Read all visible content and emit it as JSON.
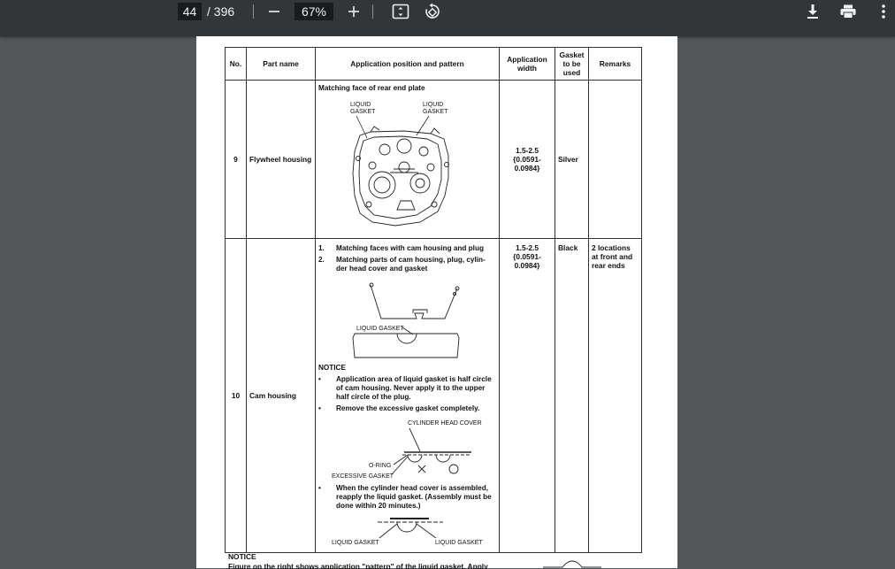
{
  "toolbar": {
    "page_current": "44",
    "page_total": "/ 396",
    "zoom": "67%"
  },
  "table": {
    "headers": {
      "no": "No.",
      "part_name": "Part name",
      "position": "Application position and pattern",
      "width": "Application width",
      "gasket": "Gasket to be used",
      "remarks": "Remarks"
    },
    "row9": {
      "no": "9",
      "part": "Flywheel housing",
      "position_title": "Matching face of rear end plate",
      "label_left_1": "LIQUID",
      "label_left_2": "GASKET",
      "label_right_1": "LIQUID",
      "label_right_2": "GASKET",
      "width_1": "1.5-2.5",
      "width_2": "{0.0591-",
      "width_3": "0.0984}",
      "gasket": "Silver",
      "remarks": ""
    },
    "row10": {
      "no": "10",
      "part": "Cam housing",
      "item1_num": "1.",
      "item1": "Matching faces with cam housing and plug",
      "item2_num": "2.",
      "item2_a": "Matching parts of cam housing, plug, cylin-",
      "item2_b": "der head cover and gasket",
      "liquid_gasket_label": "LIQUID GASKET",
      "notice_title": "NOTICE",
      "bullet1_a": "Application area of liquid gasket is half circle",
      "bullet1_b": "of cam housing. Never apply it to the upper",
      "bullet1_c": "half circle of the plug.",
      "bullet2": "Remove the excessive gasket completely.",
      "cyl_head_cover": "CYLINDER HEAD COVER",
      "o_ring": "O-RING",
      "excessive_gasket": "EXCESSIVE GASKET",
      "bullet3_a": "When the cylinder head cover is assembled,",
      "bullet3_b": "reapply the liquid gasket. (Assembly must be",
      "bullet3_c": "done within 20 minutes.)",
      "lg_left": "LIQUID GASKET",
      "lg_right": "LIQUID GASKET",
      "width_1": "1.5-2.5",
      "width_2": "{0.0591-",
      "width_3": "0.0984}",
      "gasket": "Black",
      "remarks_1": "2 locations",
      "remarks_2": "at front and",
      "remarks_3": "rear ends"
    }
  },
  "notice_footer": {
    "title": "NOTICE",
    "text": "Figure on the right shows application \"pattern\" of the liquid gasket. Apply"
  },
  "icons": [
    "minus-icon",
    "plus-icon",
    "fit-page-icon",
    "rotate-icon",
    "download-icon",
    "print-icon",
    "more-vert-icon"
  ],
  "colors": {
    "toolbar": "#323639",
    "background": "#525659",
    "paper": "#ffffff"
  }
}
